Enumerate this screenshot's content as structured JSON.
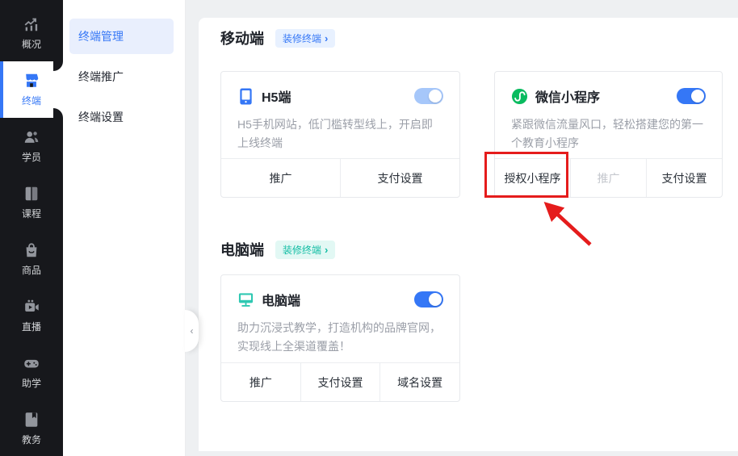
{
  "sidebar": {
    "items": [
      {
        "label": "概况",
        "active": false
      },
      {
        "label": "终端",
        "active": true
      },
      {
        "label": "学员",
        "active": false
      },
      {
        "label": "课程",
        "active": false
      },
      {
        "label": "商品",
        "active": false
      },
      {
        "label": "直播",
        "active": false
      },
      {
        "label": "助学",
        "active": false
      },
      {
        "label": "教务",
        "active": false
      }
    ]
  },
  "submenu": {
    "items": [
      {
        "label": "终端管理",
        "active": true
      },
      {
        "label": "终端推广",
        "active": false
      },
      {
        "label": "终端设置",
        "active": false
      }
    ]
  },
  "collapse_handle": {
    "glyph": "‹"
  },
  "sections": {
    "mobile": {
      "title": "移动端",
      "badge": "装修终端",
      "badge_chevron": "›"
    },
    "pc": {
      "title": "电脑端",
      "badge": "装修终端",
      "badge_chevron": "›"
    }
  },
  "cards": {
    "h5": {
      "title": "H5端",
      "description": "H5手机网站，低门槛转型线上，开启即上线终端",
      "toggle_on": true,
      "toggle_style": "light-blue",
      "actions": [
        {
          "label": "推广"
        },
        {
          "label": "支付设置"
        }
      ]
    },
    "wechat": {
      "title": "微信小程序",
      "description": "紧跟微信流量风口，轻松搭建您的第一个教育小程序",
      "toggle_on": true,
      "toggle_style": "blue",
      "actions": [
        {
          "label": "授权小程序",
          "highlighted": true
        },
        {
          "label": "推广",
          "disabled": true
        },
        {
          "label": "支付设置"
        }
      ]
    },
    "pc": {
      "title": "电脑端",
      "description": "助力沉浸式教学，打造机构的品牌官网，实现线上全渠道覆盖！",
      "toggle_on": true,
      "toggle_style": "blue",
      "actions": [
        {
          "label": "推广"
        },
        {
          "label": "支付设置"
        },
        {
          "label": "域名设置"
        }
      ]
    }
  },
  "annotation": {
    "type": "red-box-with-arrow",
    "target_label": "授权小程序"
  },
  "colors": {
    "accent_blue": "#3577f6",
    "toggle_light_blue": "#a6c7fa",
    "wechat_green": "#09bb5f",
    "teal": "#12bda4",
    "badge_blue_bg": "#e8f1ff",
    "badge_teal_bg": "#e2f8f4",
    "annotation_red": "#e51c1c",
    "sidebar_bg": "#17181c",
    "page_bg": "#eef0f2"
  }
}
